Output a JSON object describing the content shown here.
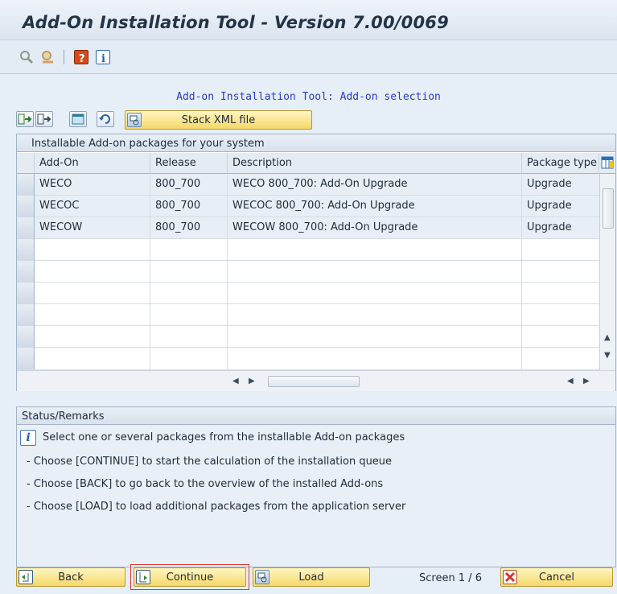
{
  "window": {
    "title": "Add-On Installation Tool - Version 7.00/0069"
  },
  "toolbar": {
    "icons": [
      "find-icon",
      "find-next-icon",
      "help-icon",
      "info-icon"
    ]
  },
  "heading": "Add-on Installation Tool: Add-on selection",
  "table_toolbar": {
    "stack_button_label": "Stack XML file",
    "icons": [
      "select-all-icon",
      "deselect-all-icon",
      "details-icon",
      "refresh-icon",
      "stack-xml-icon"
    ]
  },
  "table": {
    "title": "Installable Add-on packages for your system",
    "columns": [
      "Add-On",
      "Release",
      "Description",
      "Package type"
    ],
    "rows": [
      [
        "WECO",
        "800_700",
        "WECO 800_700: Add-On Upgrade",
        "Upgrade"
      ],
      [
        "WECOC",
        "800_700",
        "WECOC 800_700: Add-On Upgrade",
        "Upgrade"
      ],
      [
        "WECOW",
        "800_700",
        "WECOW 800_700: Add-On Upgrade",
        "Upgrade"
      ]
    ]
  },
  "status": {
    "title": "Status/Remarks",
    "lines": [
      "Select one or several packages from the installable Add-on packages",
      "- Choose [CONTINUE] to start the calculation of the installation queue",
      "- Choose [BACK] to go back to the overview of the installed Add-ons",
      "- Choose [LOAD] to load additional packages from the application server"
    ]
  },
  "footer": {
    "back_label": "Back",
    "continue_label": "Continue",
    "load_label": "Load",
    "screen_text": "Screen 1 / 6",
    "cancel_label": "Cancel"
  },
  "colors": {
    "button_yellow": "#f5d76a",
    "heading_blue": "#2b3ccc",
    "continue_focus": "#d9382c"
  }
}
